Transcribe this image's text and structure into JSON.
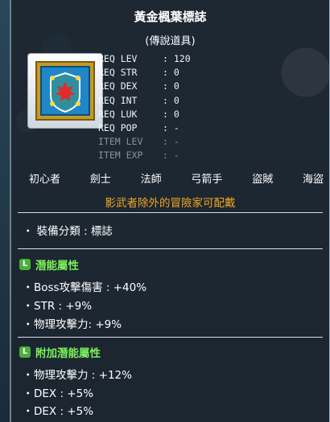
{
  "item": {
    "name": "黃金楓葉標誌",
    "rarity": "(傳說道具)"
  },
  "requirements": [
    {
      "label": "REQ LEV",
      "value": ": 120",
      "dim": false
    },
    {
      "label": "REQ STR",
      "value": ": 0",
      "dim": false
    },
    {
      "label": "REQ DEX",
      "value": ": 0",
      "dim": false
    },
    {
      "label": "REQ INT",
      "value": ": 0",
      "dim": false
    },
    {
      "label": "REQ LUK",
      "value": ": 0",
      "dim": false
    },
    {
      "label": "REQ POP",
      "value": ": -",
      "dim": false
    },
    {
      "label": "ITEM LEV",
      "value": ": -",
      "dim": true
    },
    {
      "label": "ITEM EXP",
      "value": ": -",
      "dim": true
    }
  ],
  "jobs": [
    "初心者",
    "劍士",
    "法師",
    "弓箭手",
    "盜賊",
    "海盜"
  ],
  "restriction": "影武者除外的冒險家可配戴",
  "category": "・ 裝備分類 : 標誌",
  "potential": {
    "badge": "L",
    "title": "潛能屬性",
    "lines": [
      "Boss攻擊傷害 : +40%",
      "STR : +9%",
      "物理攻擊力: +9%"
    ]
  },
  "additional": {
    "badge": "L",
    "title": "附加潛能屬性",
    "lines": [
      "物理攻擊力 : +12%",
      "DEX : +5%",
      "DEX : +5%"
    ]
  },
  "colors": {
    "restriction": "#f5a623",
    "section_title": "#7cf05a",
    "badge": "#4caf3b"
  },
  "icon": "golden-maple-emblem-icon"
}
